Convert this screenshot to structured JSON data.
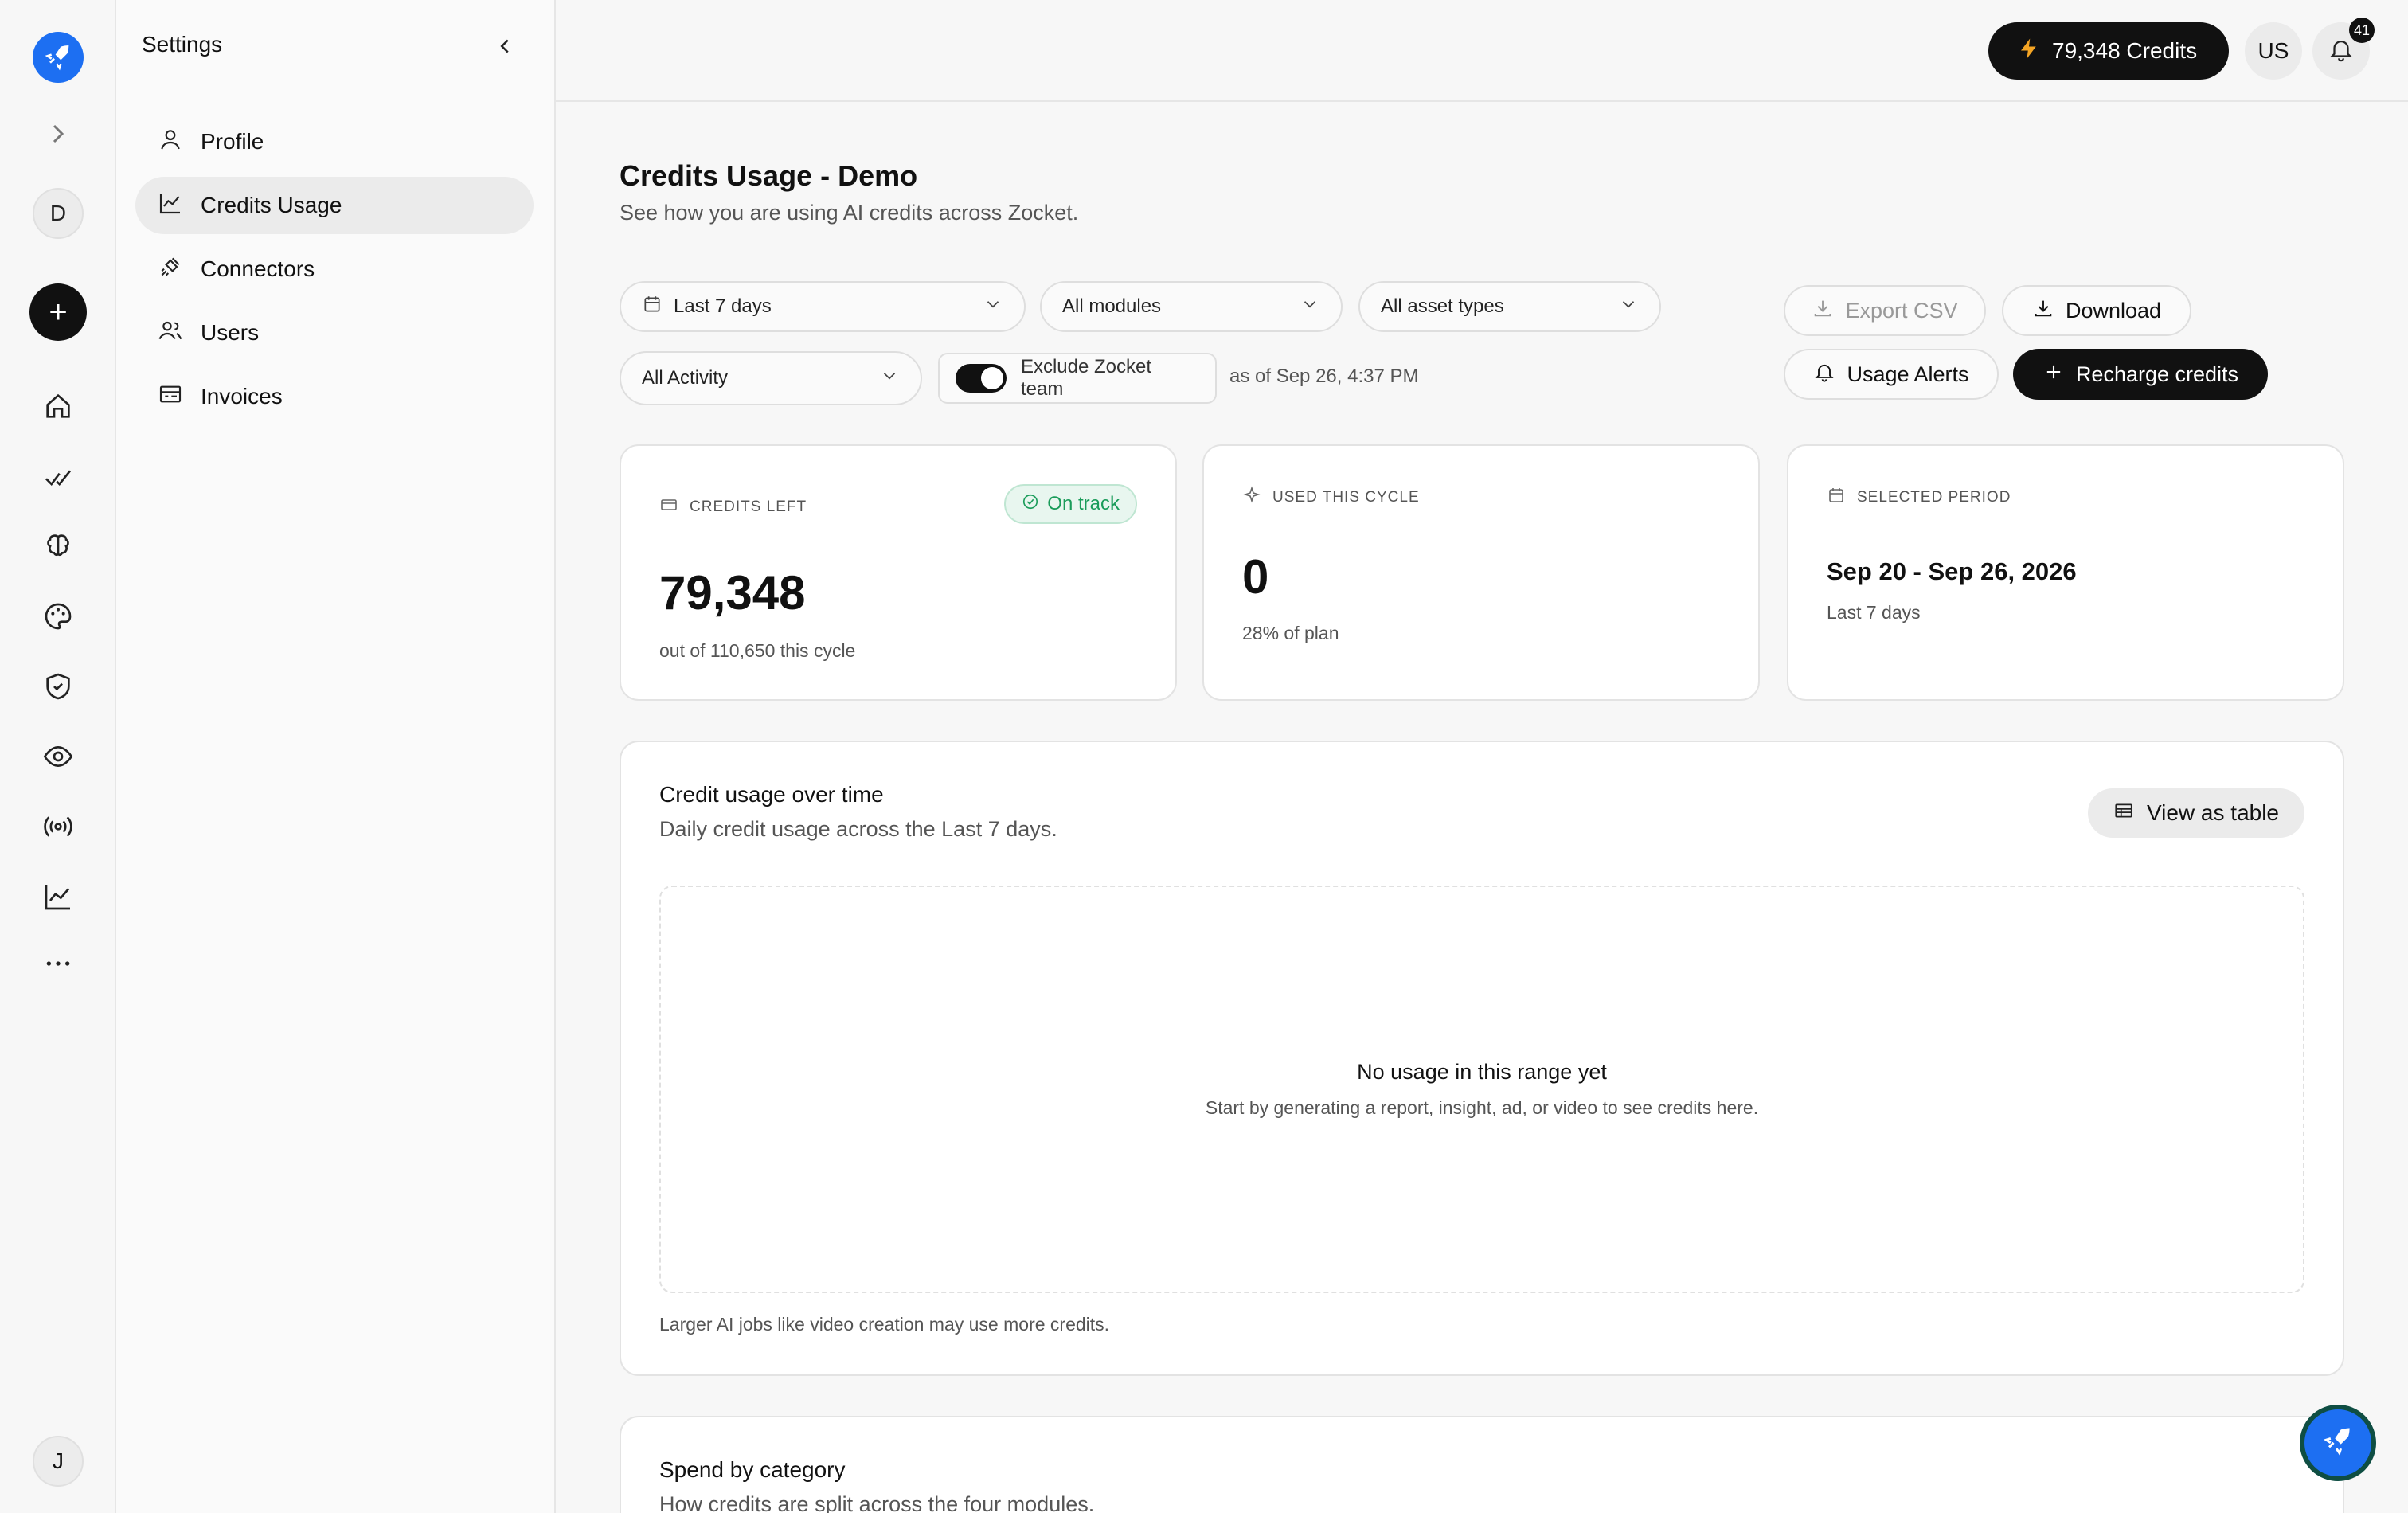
{
  "rail": {
    "logo_icon": "rocket-icon",
    "expand_icon": "chevron-right-icon",
    "workspace_initial": "D",
    "new_icon": "+",
    "nav_icons": [
      "home-icon",
      "analytics-icon",
      "brain-icon",
      "palette-icon",
      "shield-icon",
      "eye-icon",
      "broadcast-icon",
      "line-chart-icon",
      "more-icon"
    ],
    "user_initial": "J"
  },
  "settings": {
    "title": "Settings",
    "items": [
      {
        "label": "Profile",
        "icon": "user-icon"
      },
      {
        "label": "Credits Usage",
        "icon": "chart-icon",
        "active": true
      },
      {
        "label": "Connectors",
        "icon": "plug-icon"
      },
      {
        "label": "Users",
        "icon": "users-icon"
      },
      {
        "label": "Invoices",
        "icon": "invoice-icon"
      }
    ]
  },
  "topbar": {
    "credits_label": "79,348 Credits",
    "user_initials": "US",
    "notification_count": "41"
  },
  "page": {
    "title": "Credits Usage - Demo",
    "subtitle": "See how you are using AI credits across Zocket."
  },
  "filters": {
    "date_range": "Last 7 days",
    "modules": "All modules",
    "asset_types": "All asset types",
    "activity": "All Activity",
    "exclude_toggle_label": "Exclude Zocket team",
    "exclude_toggle_on": true,
    "as_of": "as of Sep 26, 4:37 PM"
  },
  "actions": {
    "export_csv": "Export CSV",
    "download": "Download",
    "usage_alerts": "Usage Alerts",
    "recharge": "Recharge credits"
  },
  "cards": {
    "credits_left": {
      "label": "CREDITS LEFT",
      "badge": "On track",
      "value": "79,348",
      "sub": "out of 110,650 this cycle"
    },
    "used_cycle": {
      "label": "USED THIS CYCLE",
      "value": "0",
      "sub": "28% of plan"
    },
    "selected_period": {
      "label": "SELECTED PERIOD",
      "value": "Sep 20 - Sep 26, 2026",
      "sub": "Last 7 days"
    }
  },
  "usage_chart": {
    "title": "Credit usage over time",
    "subtitle": "Daily credit usage across the Last 7 days.",
    "view_table": "View as table",
    "empty_title": "No usage in this range yet",
    "empty_sub": "Start by generating a report, insight, ad, or video to see credits here.",
    "note": "Larger AI jobs like video creation may use more credits."
  },
  "category": {
    "title": "Spend by category",
    "subtitle": "How credits are split across the four modules."
  },
  "colors": {
    "accent": "#1d6ff2",
    "dark": "#111111",
    "success": "#1a9c5a"
  }
}
